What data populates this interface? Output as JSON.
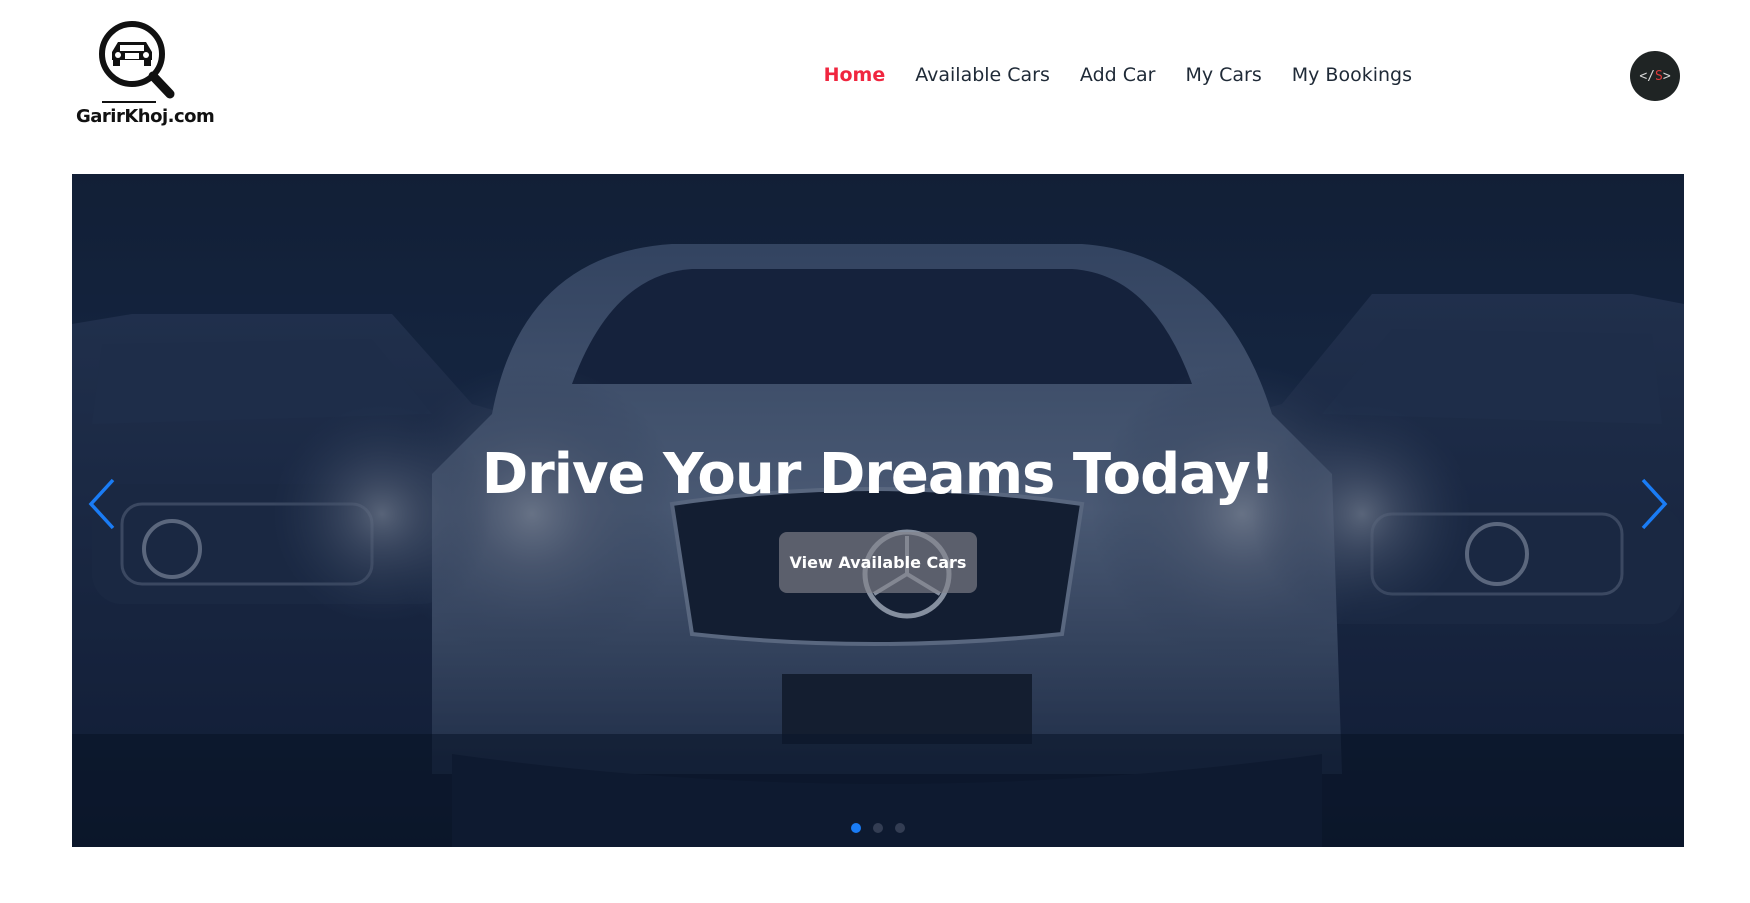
{
  "brand": {
    "logo_text": "GarirKhoj.com",
    "logo_icon": "car-search-icon"
  },
  "nav": {
    "items": [
      {
        "label": "Home",
        "active": true
      },
      {
        "label": "Available Cars",
        "active": false
      },
      {
        "label": "Add Car",
        "active": false
      },
      {
        "label": "My Cars",
        "active": false
      },
      {
        "label": "My Bookings",
        "active": false
      }
    ],
    "dev_badge": {
      "left": "</",
      "mid": "S",
      "right": ">"
    }
  },
  "hero": {
    "title": "Drive Your Dreams Today!",
    "button_label": "View Available Cars",
    "prev_icon": "chevron-left-icon",
    "next_icon": "chevron-right-icon",
    "slides_count": 3,
    "active_slide": 1
  },
  "colors": {
    "accent_active_nav": "#f0263f",
    "carousel_arrow": "#1a7cf5",
    "active_dot": "#1a7cf5",
    "hero_overlay": "#0a162d"
  }
}
